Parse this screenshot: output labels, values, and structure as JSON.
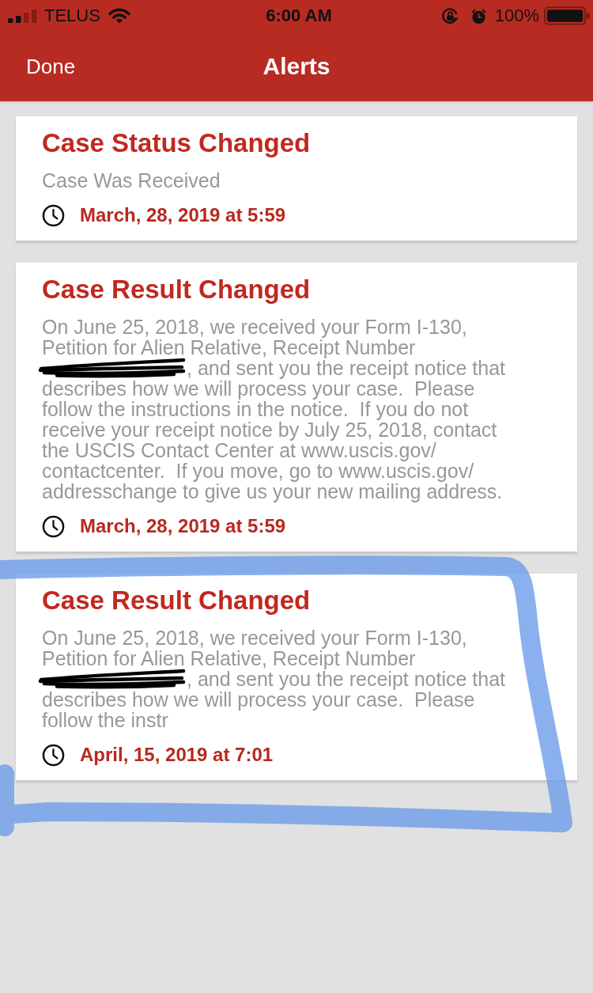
{
  "status_bar": {
    "carrier": "TELUS",
    "time": "6:00 AM",
    "battery": "100%"
  },
  "nav": {
    "left_button": "Done",
    "title": "Alerts"
  },
  "alerts": [
    {
      "title": "Case Status Changed",
      "body": [
        {
          "kind": "text",
          "text": "Case Was Received"
        }
      ],
      "timestamp": "March, 28, 2019 at 5:59",
      "highlighted": false
    },
    {
      "title": "Case Result Changed",
      "body": [
        {
          "kind": "text",
          "text": "On June 25, 2018, we received your Form I-130, Petition for Alien Relative, Receipt Number"
        },
        {
          "kind": "redaction"
        },
        {
          "kind": "text",
          "text": ", and sent you the receipt notice that describes how we will process your case.  Please follow the instructions in the notice.  If you do not receive your receipt notice by July 25, 2018, contact the USCIS Contact Center at www.uscis.gov/contactcenter.  If you move, go to www.uscis.gov/addresschange to give us your new mailing address."
        }
      ],
      "timestamp": "March, 28, 2019 at 5:59",
      "highlighted": false
    },
    {
      "title": "Case Result Changed",
      "body": [
        {
          "kind": "text",
          "text": "On June 25, 2018, we received your Form I-130, Petition for Alien Relative, Receipt Number"
        },
        {
          "kind": "redaction"
        },
        {
          "kind": "text",
          "text": ", and sent you the receipt notice that describes how we will process your case.  Please follow the instr"
        }
      ],
      "timestamp": "April, 15, 2019 at 7:01",
      "highlighted": true
    }
  ]
}
